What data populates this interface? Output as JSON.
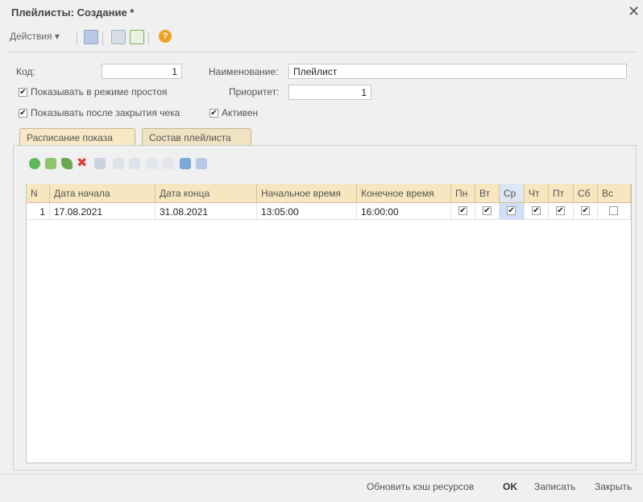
{
  "window": {
    "title": "Плейлисты: Создание *",
    "close_symbol": "✕"
  },
  "toolbar": {
    "actions_label": "Действия ▾"
  },
  "form": {
    "code_label": "Код:",
    "code_value": "1",
    "name_label": "Наименование:",
    "name_value": "Плейлист",
    "show_idle_label": "Показывать в режиме простоя",
    "show_idle_checked": true,
    "priority_label": "Приоритет:",
    "priority_value": "1",
    "show_after_check_label": "Показывать после закрытия чека",
    "show_after_check_checked": true,
    "active_label": "Активен",
    "active_checked": true
  },
  "tabs": [
    {
      "label": "Расписание показа",
      "active": true
    },
    {
      "label": "Состав плейлиста",
      "active": false
    }
  ],
  "table": {
    "columns": [
      "N",
      "Дата начала",
      "Дата конца",
      "Начальное время",
      "Конечное время",
      "Пн",
      "Вт",
      "Ср",
      "Чт",
      "Пт",
      "Сб",
      "Вс"
    ],
    "rows": [
      {
        "n": "1",
        "start_date": "17.08.2021",
        "end_date": "31.08.2021",
        "start_time": "13:05:00",
        "end_time": "16:00:00",
        "days": [
          true,
          true,
          true,
          true,
          true,
          true,
          false
        ]
      }
    ],
    "selected_column": "Ср"
  },
  "footer": {
    "refresh_cache_label": "Обновить кэш ресурсов",
    "ok_label": "OK",
    "save_label": "Записать",
    "close_label": "Закрыть"
  },
  "colors": {
    "tab_active": "#f7e9c6",
    "header_bg": "#f6e7c0",
    "selection": "#cfe0f6"
  }
}
